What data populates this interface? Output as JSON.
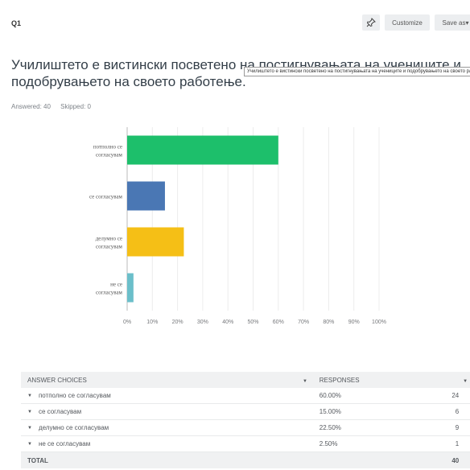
{
  "question": {
    "label": "Q1",
    "text": "Училиштето е вистински посветено на постигнувањата на учениците и подобрувањето на своето работење.",
    "tooltip": "Училиштето е вистински посветено на постигнувањата на учениците и подобрувањето на своето работење.",
    "answered_label": "Answered: 40",
    "skipped_label": "Skipped: 0"
  },
  "toolbar": {
    "pin_icon": "pin-icon",
    "customize_label": "Customize",
    "save_label": "Save as▾"
  },
  "chart_data": {
    "type": "bar",
    "orientation": "horizontal",
    "categories": [
      "потполно се согласувам",
      "се согласувам",
      "делумно се согласувам",
      "не се согласувам"
    ],
    "category_lines": [
      [
        "потполно се",
        "согласувам"
      ],
      [
        "се согласувам"
      ],
      [
        "делумно се",
        "согласувам"
      ],
      [
        "не се",
        "согласувам"
      ]
    ],
    "values": [
      60,
      15,
      22.5,
      2.5
    ],
    "colors": [
      "#1dbf6b",
      "#4a77b4",
      "#f5bf16",
      "#6bbfca"
    ],
    "xlim": [
      0,
      100
    ],
    "xticks": [
      "0%",
      "10%",
      "20%",
      "30%",
      "40%",
      "50%",
      "60%",
      "70%",
      "80%",
      "90%",
      "100%"
    ],
    "grid": true
  },
  "table": {
    "header": {
      "choices": "ANSWER CHOICES",
      "responses": "RESPONSES"
    },
    "rows": [
      {
        "choice": "потполно се согласувам",
        "percent": "60.00%",
        "count": "24"
      },
      {
        "choice": "се согласувам",
        "percent": "15.00%",
        "count": "6"
      },
      {
        "choice": "делумно се согласувам",
        "percent": "22.50%",
        "count": "9"
      },
      {
        "choice": "не се согласувам",
        "percent": "2.50%",
        "count": "1"
      }
    ],
    "total_label": "TOTAL",
    "total_count": "40"
  }
}
